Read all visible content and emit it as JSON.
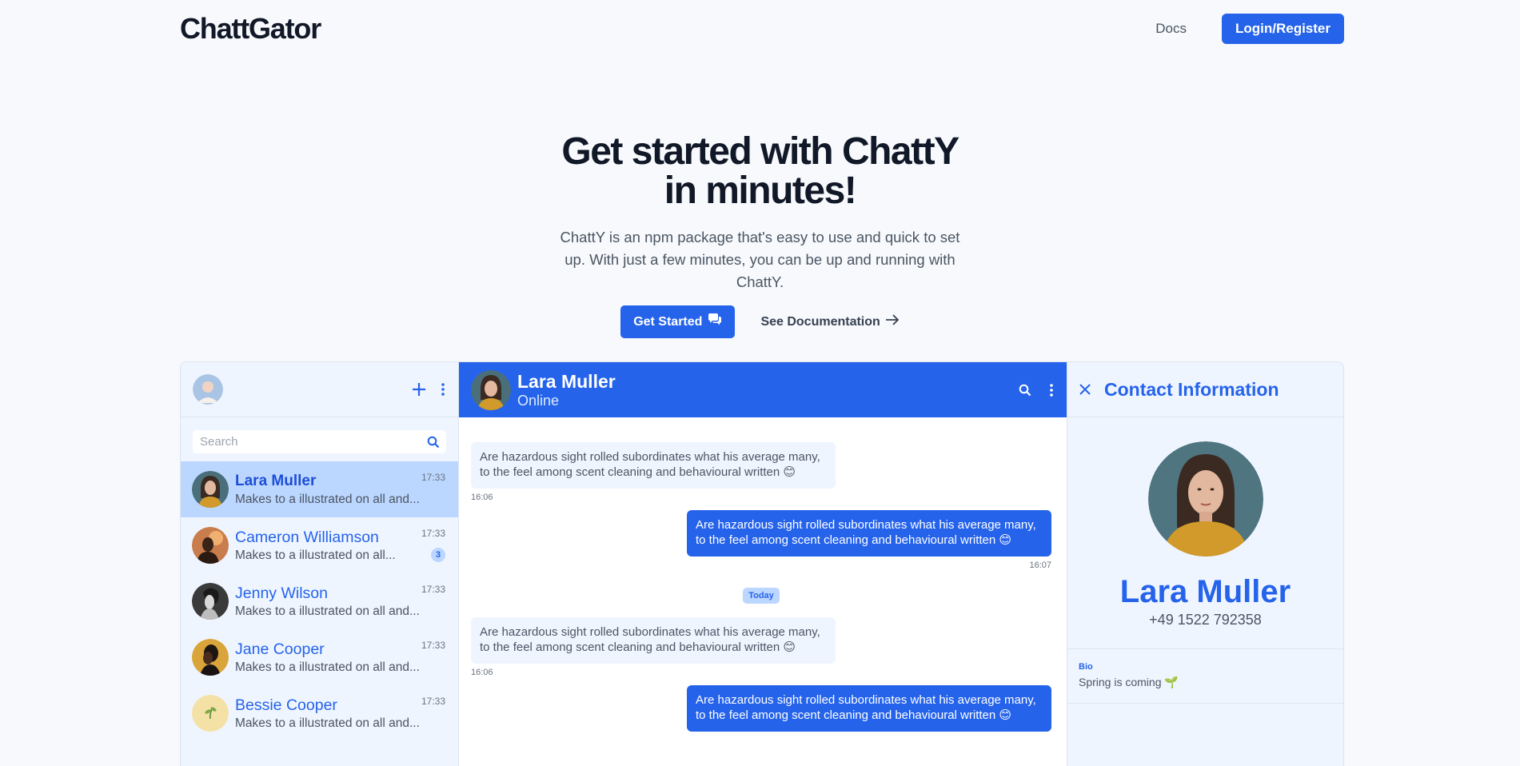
{
  "nav": {
    "logo": "ChattGator",
    "docs": "Docs",
    "login": "Login/Register"
  },
  "hero": {
    "title_line1": "Get started with ChattY",
    "title_line2": "in minutes!",
    "description": "ChattY is an npm package that's easy to use and quick to set up. With just a few minutes, you can be up and running with ChattY.",
    "get_started": "Get Started",
    "see_docs": "See Documentation"
  },
  "sidebar": {
    "search_placeholder": "Search",
    "contacts": [
      {
        "name": "Lara Muller",
        "message": "Makes to a illustrated on all and...",
        "time": "17:33",
        "badge": ""
      },
      {
        "name": "Cameron Williamson",
        "message": "Makes to a illustrated on all...",
        "time": "17:33",
        "badge": "3"
      },
      {
        "name": "Jenny Wilson",
        "message": "Makes to a illustrated on all and...",
        "time": "17:33",
        "badge": ""
      },
      {
        "name": "Jane Cooper",
        "message": "Makes to a illustrated on all and...",
        "time": "17:33",
        "badge": ""
      },
      {
        "name": "Bessie Cooper",
        "message": "Makes to a illustrated on all and...",
        "time": "17:33",
        "badge": ""
      }
    ]
  },
  "chat": {
    "name": "Lara Muller",
    "status": "Online",
    "messages": [
      {
        "text": "Are hazardous sight rolled subordinates what his average many, to the feel among scent cleaning and behavioural written 😊",
        "time": "16:06"
      },
      {
        "text": "Are hazardous sight rolled subordinates what his average many, to the feel among scent cleaning and behavioural written 😊",
        "time": "16:07"
      },
      {
        "text": "Are hazardous sight rolled subordinates what his average many, to the feel among scent cleaning and behavioural written 😊",
        "time": "16:06"
      },
      {
        "text": "Are hazardous sight rolled subordinates what his average many, to the feel among scent cleaning and behavioural written 😊",
        "time": ""
      }
    ],
    "divider": "Today"
  },
  "info": {
    "title": "Contact Information",
    "name": "Lara Muller",
    "phone": "+49 1522 792358",
    "bio_label": "Bio",
    "bio_text": "Spring is coming 🌱"
  },
  "colors": {
    "accent": "#2563eb",
    "panel": "#eff5ff",
    "active": "#bcd7ff"
  }
}
